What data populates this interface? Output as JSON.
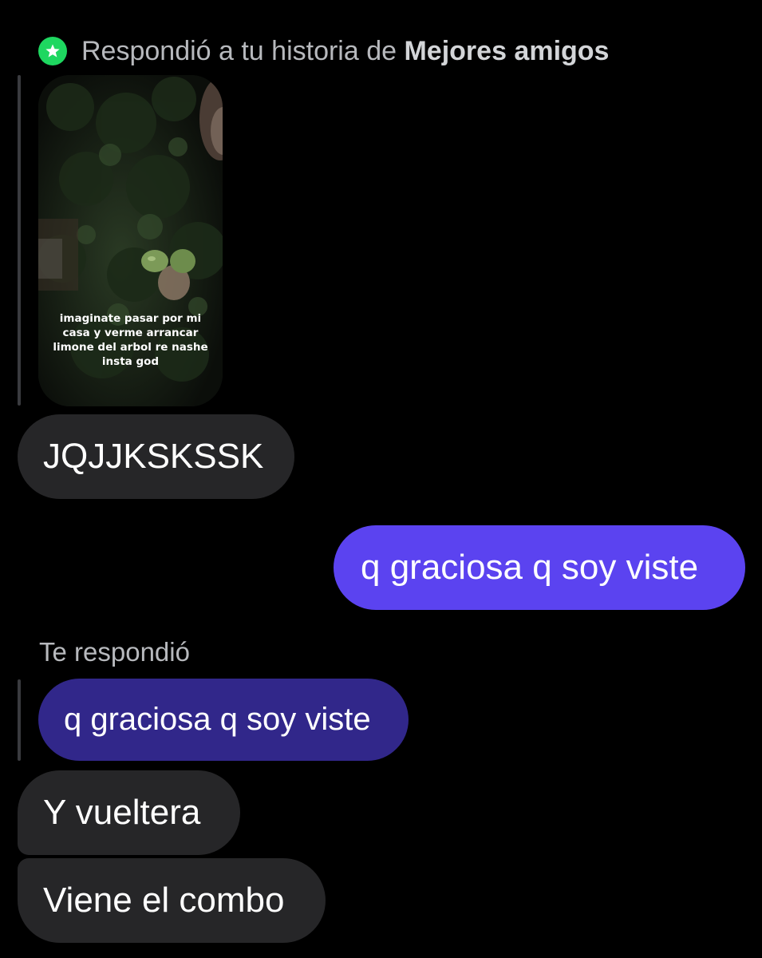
{
  "story_reply": {
    "prefix": "Respondió a tu historia de ",
    "audience": "Mejores amigos",
    "badge_icon": "star-icon",
    "badge_color": "#1ed760",
    "story_caption": "imaginate pasar por mi casa y verme arrancar limone del arbol re nashe insta god"
  },
  "messages": [
    {
      "id": "m1",
      "direction": "received",
      "text": "JQJJKSKSSK"
    },
    {
      "id": "m2",
      "direction": "sent",
      "text": "q graciosa q soy viste"
    },
    {
      "id": "m3",
      "direction": "received",
      "reply_label": "Te respondió",
      "quoted_text": "q graciosa q soy viste"
    },
    {
      "id": "m4",
      "direction": "received",
      "text": "Y vueltera"
    },
    {
      "id": "m5",
      "direction": "received",
      "text": "Viene el combo"
    }
  ],
  "colors": {
    "background": "#000000",
    "received_bubble": "#262628",
    "sent_bubble": "#5b43f0",
    "quoted_bubble": "#31278a"
  }
}
